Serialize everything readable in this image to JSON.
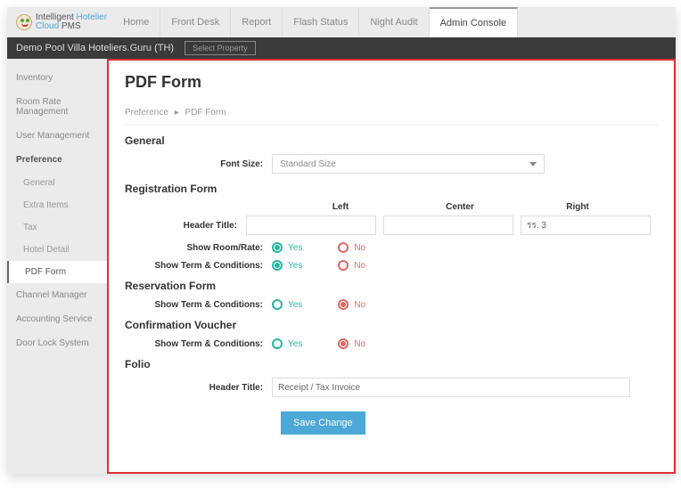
{
  "logo": {
    "line1": "Intelligent Hotelier",
    "line2": "Cloud PMS"
  },
  "nav": [
    "Home",
    "Front Desk",
    "Report",
    "Flash Status",
    "Night Audit",
    "Admin Console"
  ],
  "nav_active_index": 5,
  "subbar": {
    "property": "Demo Pool Villa Hoteliers.Guru (TH)",
    "select_btn": "Select Property"
  },
  "sidebar": {
    "items_top": [
      "Inventory",
      "Room Rate Management",
      "User Management"
    ],
    "pref_label": "Preference",
    "pref_subs": [
      "General",
      "Extra Items",
      "Tax",
      "Hotel Detail",
      "PDF Form"
    ],
    "pref_active_index": 4,
    "items_bottom": [
      "Channel Manager",
      "Accounting Service",
      "Door Lock System"
    ]
  },
  "page": {
    "title": "PDF Form",
    "crumb_root": "Preference",
    "crumb_leaf": "PDF Form",
    "general": {
      "heading": "General",
      "font_label": "Font Size:",
      "font_value": "Standard Size"
    },
    "registration": {
      "heading": "Registration Form",
      "col_left": "Left",
      "col_center": "Center",
      "col_right": "Right",
      "header_title_label": "Header Title:",
      "right_value": "รร. 3",
      "row_room": "Show Room/Rate:",
      "row_terms": "Show Term & Conditions:"
    },
    "reservation": {
      "heading": "Reservation Form",
      "row_terms": "Show Term & Conditions:"
    },
    "confirmation": {
      "heading": "Confirmation Voucher",
      "row_terms": "Show Term & Conditions:"
    },
    "folio": {
      "heading": "Folio",
      "header_title_label": "Header Title:",
      "value": "Receipt / Tax Invoice"
    },
    "yes": "Yes",
    "no": "No",
    "save_btn": "Save Change"
  }
}
